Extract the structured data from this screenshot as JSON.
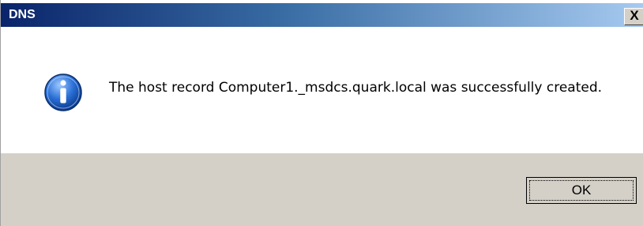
{
  "window": {
    "title": "DNS",
    "close_glyph": "X"
  },
  "message": {
    "text": "The host record Computer1._msdcs.quark.local was successfully created.",
    "icon": "information-icon"
  },
  "buttons": {
    "ok_label": "OK"
  },
  "colors": {
    "titlebar_start": "#0a246a",
    "titlebar_end": "#a6caf0",
    "icon_blue": "#2a6fd6"
  }
}
